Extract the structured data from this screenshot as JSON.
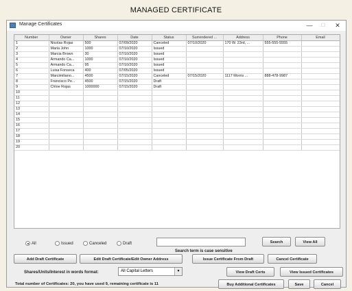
{
  "caption": "MANAGED CERTIFICATE",
  "window": {
    "title": "Manage Certificates",
    "controls": {
      "minimize": "—",
      "maximize": "☐",
      "close": "✕"
    }
  },
  "table": {
    "columns": [
      "Number",
      "Owner",
      "Shares",
      "Date",
      "Status",
      "Surrendered ...",
      "Address",
      "Phone",
      "Email"
    ],
    "rows": [
      [
        "1",
        "Nicolas Rojas",
        "500",
        "07/09/2020",
        "Canceled",
        "07/10/2020",
        "170 W. 23rd, ...",
        "555-555-5555",
        ""
      ],
      [
        "2",
        "Maria John",
        "1000",
        "07/10/2020",
        "Issued",
        "",
        "",
        "",
        ""
      ],
      [
        "3",
        "Marcia Brown",
        "30",
        "07/10/2020",
        "Issued",
        "",
        "",
        "",
        ""
      ],
      [
        "4",
        "Armando Ca...",
        "1000",
        "07/10/2020",
        "Issued",
        "",
        "",
        "",
        ""
      ],
      [
        "5",
        "Armando Ca...",
        "95",
        "07/10/2020",
        "Issued",
        "",
        "",
        "",
        ""
      ],
      [
        "6",
        "Luisa Fonseca",
        "400",
        "07/05/2020",
        "Issued",
        "",
        "",
        "",
        ""
      ],
      [
        "7",
        "Marcimiliano...",
        "4500",
        "07/15/2020",
        "Canceled",
        "07/15/2020",
        "1117 Morris ...",
        "888-478-9987",
        ""
      ],
      [
        "8",
        "Francisco Pe...",
        "4500",
        "07/15/2020",
        "Draft",
        "",
        "",
        "",
        ""
      ],
      [
        "9",
        "Chloe Rojas",
        "1000000",
        "07/15/2020",
        "Draft",
        "",
        "",
        "",
        ""
      ],
      [
        "10",
        "",
        "",
        "",
        "",
        "",
        "",
        "",
        ""
      ],
      [
        "11",
        "",
        "",
        "",
        "",
        "",
        "",
        "",
        ""
      ],
      [
        "12",
        "",
        "",
        "",
        "",
        "",
        "",
        "",
        ""
      ],
      [
        "13",
        "",
        "",
        "",
        "",
        "",
        "",
        "",
        ""
      ],
      [
        "14",
        "",
        "",
        "",
        "",
        "",
        "",
        "",
        ""
      ],
      [
        "15",
        "",
        "",
        "",
        "",
        "",
        "",
        "",
        ""
      ],
      [
        "16",
        "",
        "",
        "",
        "",
        "",
        "",
        "",
        ""
      ],
      [
        "17",
        "",
        "",
        "",
        "",
        "",
        "",
        "",
        ""
      ],
      [
        "18",
        "",
        "",
        "",
        "",
        "",
        "",
        "",
        ""
      ],
      [
        "19",
        "",
        "",
        "",
        "",
        "",
        "",
        "",
        ""
      ],
      [
        "20",
        "",
        "",
        "",
        "",
        "",
        "",
        "",
        ""
      ]
    ]
  },
  "filters": {
    "all": "All",
    "issued": "Issued",
    "canceled": "Canceled",
    "draft": "Draft",
    "selected": "all"
  },
  "search": {
    "value": "",
    "hint": "Search term is case sensitive",
    "search_label": "Search",
    "view_all_label": "View All"
  },
  "actions": {
    "add_draft": "Add Draft Certificate",
    "edit_draft": "Edit Draft Certificate/Edit Owner Address",
    "issue": "Issue Certificate From Draft",
    "cancel_cert": "Cancel Certificate"
  },
  "format": {
    "label": "Shares/Units/Interest in words format:",
    "selected": "All Capital Letters"
  },
  "view": {
    "drafts": "View Draft Certs",
    "issued": "View Issued Certificates"
  },
  "footer": {
    "status": "Total number of Certificates: 20, you have used 9, remaining certificate is 11",
    "buy": "Buy Additional Certificates",
    "save": "Save",
    "cancel": "Cancel"
  }
}
